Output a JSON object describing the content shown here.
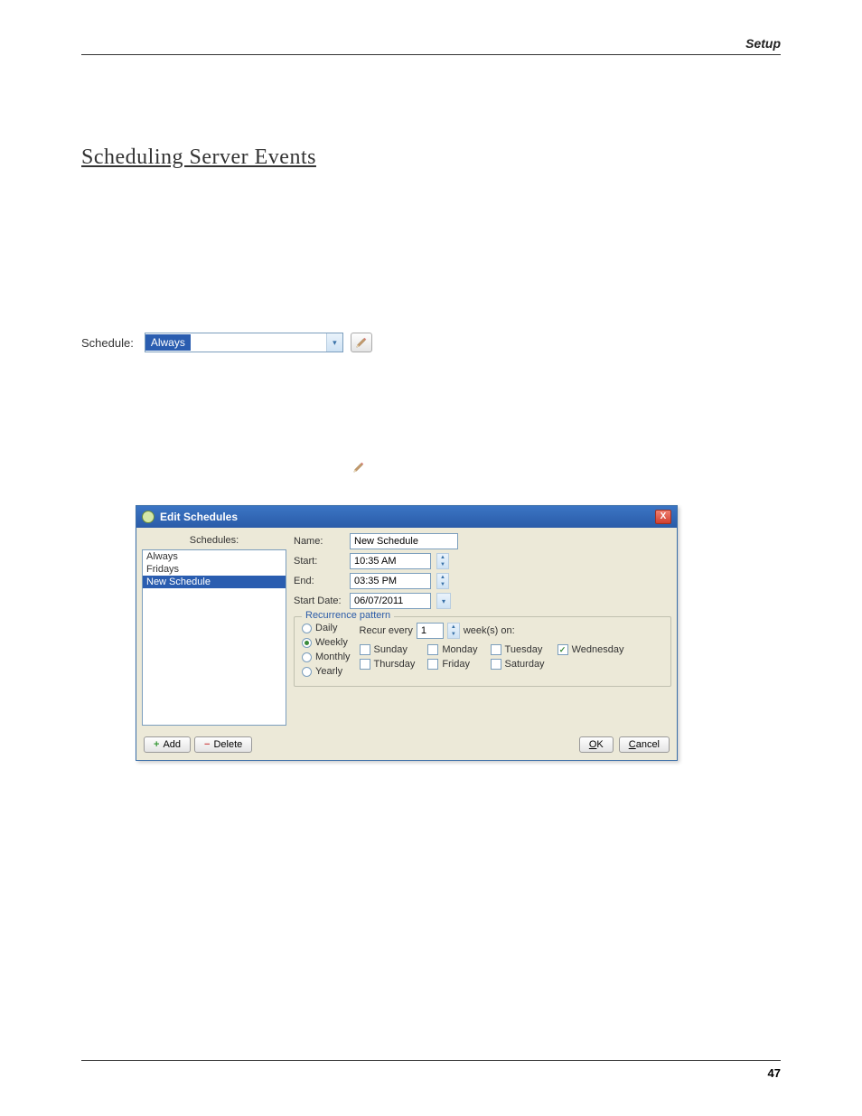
{
  "header": {
    "breadcrumb": "Setup"
  },
  "section": {
    "title": "Scheduling Server Events"
  },
  "scheduleBar": {
    "label": "Schedule:",
    "selected": "Always"
  },
  "dialog": {
    "title": "Edit Schedules",
    "closeLabel": "X",
    "schedulesLabel": "Schedules:",
    "list": [
      "Always",
      "Fridays",
      "New Schedule"
    ],
    "selectedIndex": 2,
    "fields": {
      "nameLabel": "Name:",
      "nameValue": "New Schedule",
      "startLabel": "Start:",
      "startValue": "10:35 AM",
      "endLabel": "End:",
      "endValue": "03:35 PM",
      "startDateLabel": "Start Date:",
      "startDateValue": "06/07/2011"
    },
    "recurrence": {
      "title": "Recurrence pattern",
      "daily": "Daily",
      "weekly": "Weekly",
      "monthly": "Monthly",
      "yearly": "Yearly",
      "recurEveryLabel": "Recur every",
      "recurEveryValue": "1",
      "weeksOn": "week(s) on:",
      "days": {
        "sunday": "Sunday",
        "monday": "Monday",
        "tuesday": "Tuesday",
        "wednesday": "Wednesday",
        "thursday": "Thursday",
        "friday": "Friday",
        "saturday": "Saturday"
      },
      "checked": "wednesday"
    },
    "buttons": {
      "add": "Add",
      "delete": "Delete",
      "ok": "OK",
      "cancel": "Cancel"
    }
  },
  "footer": {
    "page": "47"
  }
}
